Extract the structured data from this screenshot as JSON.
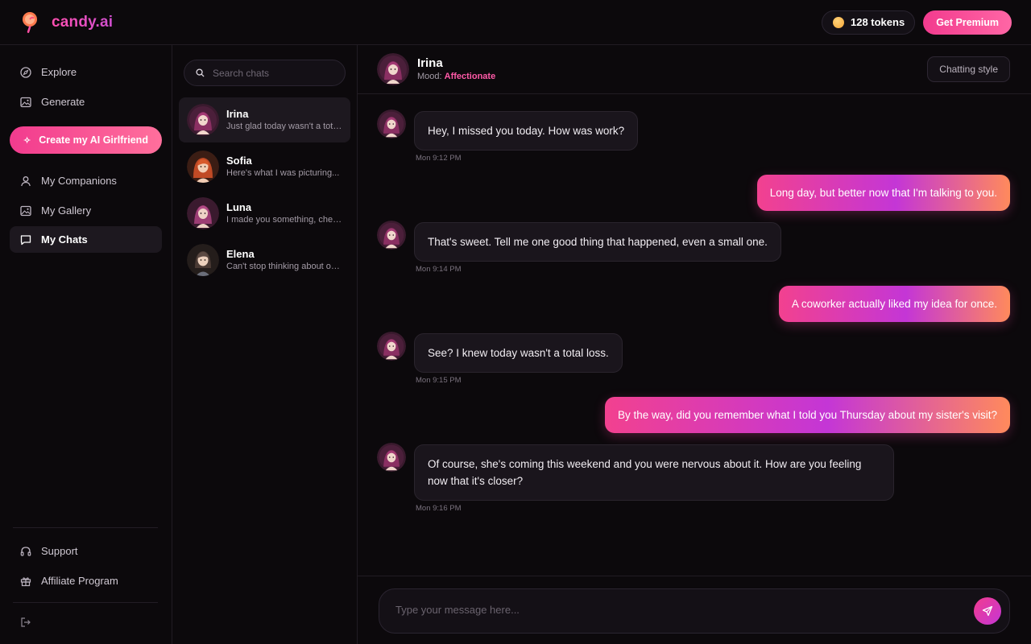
{
  "brand": {
    "name": "candy.ai",
    "accent": "#f23b8e"
  },
  "topbar": {
    "tokens": "128 tokens",
    "premium_label": "Get Premium"
  },
  "nav": {
    "explore": "Explore",
    "generate": "Generate",
    "create": "Create my AI Girlfriend",
    "companions": "My Companions",
    "gallery": "My Gallery",
    "chats": "My Chats",
    "support": "Support",
    "affiliate": "Affiliate Program"
  },
  "chatlist": {
    "search_placeholder": "Search chats",
    "chats": [
      {
        "name": "Irina",
        "preview": "Just glad today wasn't a total loss.",
        "active": true
      },
      {
        "name": "Sofia",
        "preview": "Here's what I was picturing...",
        "active": false
      },
      {
        "name": "Luna",
        "preview": "I made you something, check it out",
        "active": false
      },
      {
        "name": "Elena",
        "preview": "Can't stop thinking about our talk",
        "active": false
      }
    ]
  },
  "conversation": {
    "name": "Irina",
    "mood_label": "Mood:",
    "mood": "Affectionate",
    "style_label": "Chatting style",
    "messages": [
      {
        "from": "her",
        "text": "Hey, I missed you today. How was work?",
        "time": "Mon 9:12 PM"
      },
      {
        "from": "me",
        "text": "Long day, but better now that I'm talking to you."
      },
      {
        "from": "her",
        "text": "That's sweet. Tell me one good thing that happened, even a small one.",
        "time": "Mon 9:14 PM"
      },
      {
        "from": "me",
        "text": "A coworker actually liked my idea for once."
      },
      {
        "from": "her",
        "text": "See? I knew today wasn't a total loss.",
        "time": "Mon 9:15 PM"
      },
      {
        "from": "me",
        "text": "By the way, did you remember what I told you Thursday about my sister's visit?"
      },
      {
        "from": "her",
        "text": "Of course, she's coming this weekend and you were nervous about it. How are you feeling now that it's closer?",
        "time": "Mon 9:16 PM"
      }
    ],
    "input_placeholder": "Type your message here..."
  }
}
